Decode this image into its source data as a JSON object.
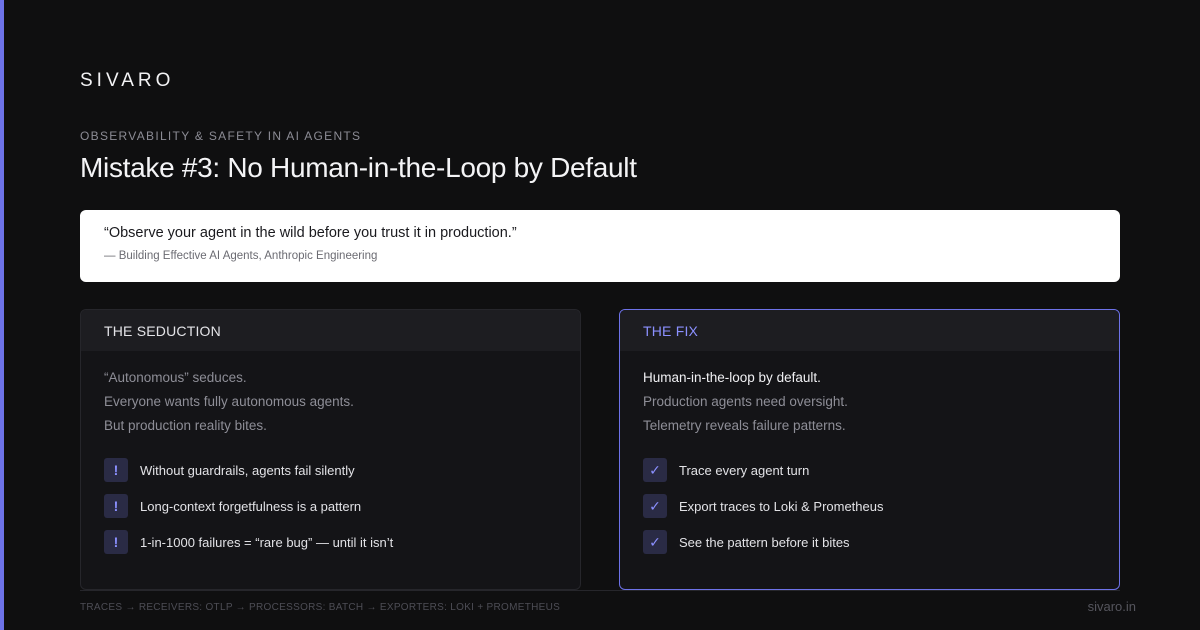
{
  "brand": "SIVARO",
  "kicker": "OBSERVABILITY & SAFETY IN AI AGENTS",
  "title": "Mistake #3: No Human-in-the-Loop by Default",
  "quote": {
    "text": "“Observe your agent in the wild before you trust it in production.”",
    "source": "— Building Effective AI Agents, Anthropic Engineering"
  },
  "seduction": {
    "heading": "THE SEDUCTION",
    "lines": [
      "“Autonomous” seduces.",
      "Everyone wants fully autonomous agents.",
      "But production reality bites."
    ],
    "items": [
      {
        "icon": "!",
        "label": "Without guardrails, agents fail silently"
      },
      {
        "icon": "!",
        "label": "Long-context forgetfulness is a pattern"
      },
      {
        "icon": "!",
        "label": "1-in-1000 failures = “rare bug” — until it isn’t"
      }
    ]
  },
  "fix": {
    "heading": "THE FIX",
    "lines": [
      "Human-in-the-loop by default.",
      "Production agents need oversight.",
      "Telemetry reveals failure patterns."
    ],
    "items": [
      {
        "icon": "✓",
        "label": "Trace every agent turn"
      },
      {
        "icon": "✓",
        "label": "Export traces to Loki & Prometheus"
      },
      {
        "icon": "✓",
        "label": "See the pattern before it bites"
      }
    ]
  },
  "footer": {
    "pipeline": "TRACES → RECEIVERS: OTLP → PROCESSORS: BATCH → EXPORTERS: LOKI + PROMETHEUS",
    "site": "sivaro.in"
  },
  "colors": {
    "accent": "#6d72e8",
    "accent_text": "#8b90ff",
    "background": "#0f0f10"
  }
}
